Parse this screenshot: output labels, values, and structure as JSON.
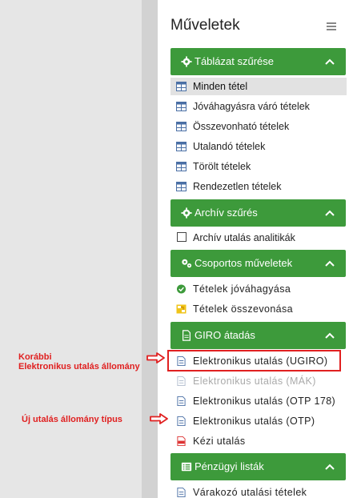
{
  "panel": {
    "title": "Műveletek",
    "menu_icon": "hamburger-icon"
  },
  "sections": {
    "table_filter": {
      "title": "Táblázat szűrése",
      "icon": "gear-icon",
      "items": [
        {
          "label": "Minden tétel",
          "icon": "table-icon",
          "active": true
        },
        {
          "label": "Jóváhagyásra váró tételek",
          "icon": "table-icon"
        },
        {
          "label": "Összevonható tételek",
          "icon": "table-icon"
        },
        {
          "label": "Utalandó tételek",
          "icon": "table-icon"
        },
        {
          "label": "Törölt tételek",
          "icon": "table-icon"
        },
        {
          "label": "Rendezetlen tételek",
          "icon": "table-icon"
        }
      ]
    },
    "archive_filter": {
      "title": "Archív szűrés",
      "icon": "gear-icon",
      "items": [
        {
          "label": "Archív utalás analitikák",
          "icon": "checkbox-icon",
          "checked": false
        }
      ]
    },
    "group_ops": {
      "title": "Csoportos műveletek",
      "icon": "gears-icon",
      "items": [
        {
          "label": "Tételek jóváhagyása",
          "icon": "check-circle-icon"
        },
        {
          "label": "Tételek összevonása",
          "icon": "merge-icon"
        }
      ]
    },
    "giro": {
      "title": "GIRO átadás",
      "icon": "file-icon",
      "items": [
        {
          "label": "Elektronikus utalás (UGIRO)",
          "icon": "file-icon"
        },
        {
          "label": "Elektronikus utalás (MÁK)",
          "icon": "file-icon",
          "disabled": true
        },
        {
          "label": "Elektronikus utalás (OTP 178)",
          "icon": "file-icon"
        },
        {
          "label": "Elektronikus utalás (OTP)",
          "icon": "file-icon"
        },
        {
          "label": "Kézi utalás",
          "icon": "pdf-icon"
        }
      ]
    },
    "finance_lists": {
      "title": "Pénzügyi listák",
      "icon": "list-icon",
      "items": [
        {
          "label": "Várakozó utalási tételek",
          "icon": "file-icon"
        }
      ]
    }
  },
  "annotations": {
    "previous_line1": "Korábbi",
    "previous_line2": "Elektronikus utalás állomány",
    "new_type": "Új utalás állomány típus"
  },
  "colors": {
    "section_green": "#3d9a3b",
    "annotation_red": "#e02020",
    "icon_blue": "#4a6fa5",
    "check_green": "#3d9a3b",
    "merge_yellow": "#f0c419"
  }
}
